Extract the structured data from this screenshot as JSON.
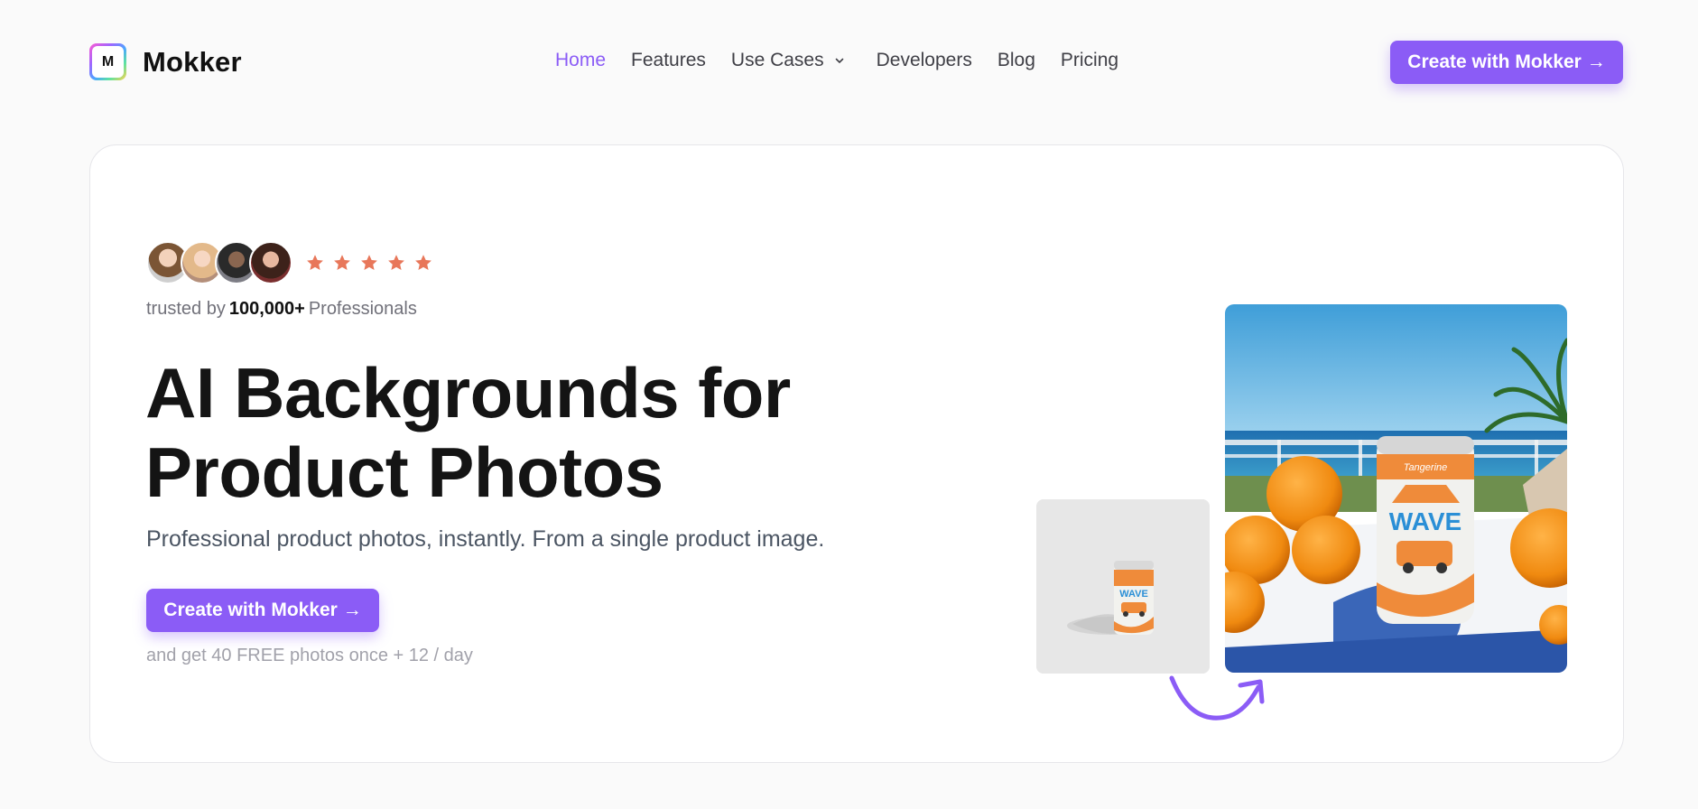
{
  "brand": {
    "logo_letter": "M",
    "name": "Mokker",
    "accent_color": "#8b5cf6"
  },
  "nav": {
    "items": [
      {
        "label": "Home",
        "active": true
      },
      {
        "label": "Features",
        "active": false
      },
      {
        "label": "Use Cases",
        "active": false,
        "has_dropdown": true
      },
      {
        "label": "Developers",
        "active": false
      },
      {
        "label": "Blog",
        "active": false
      },
      {
        "label": "Pricing",
        "active": false
      }
    ],
    "cta_label": "Create with Mokker →"
  },
  "hero": {
    "rating_stars": 5,
    "star_color": "#e8775a",
    "trusted_prefix": "trusted by",
    "trusted_count": "100,000+",
    "trusted_suffix": "Professionals",
    "headline_line1": "AI Backgrounds for",
    "headline_line2": "Product Photos",
    "subheadline": "Professional product photos, instantly. From a single product image.",
    "cta_label": "Create with Mokker →",
    "note": "and get 40 FREE photos once + 12 / day"
  }
}
